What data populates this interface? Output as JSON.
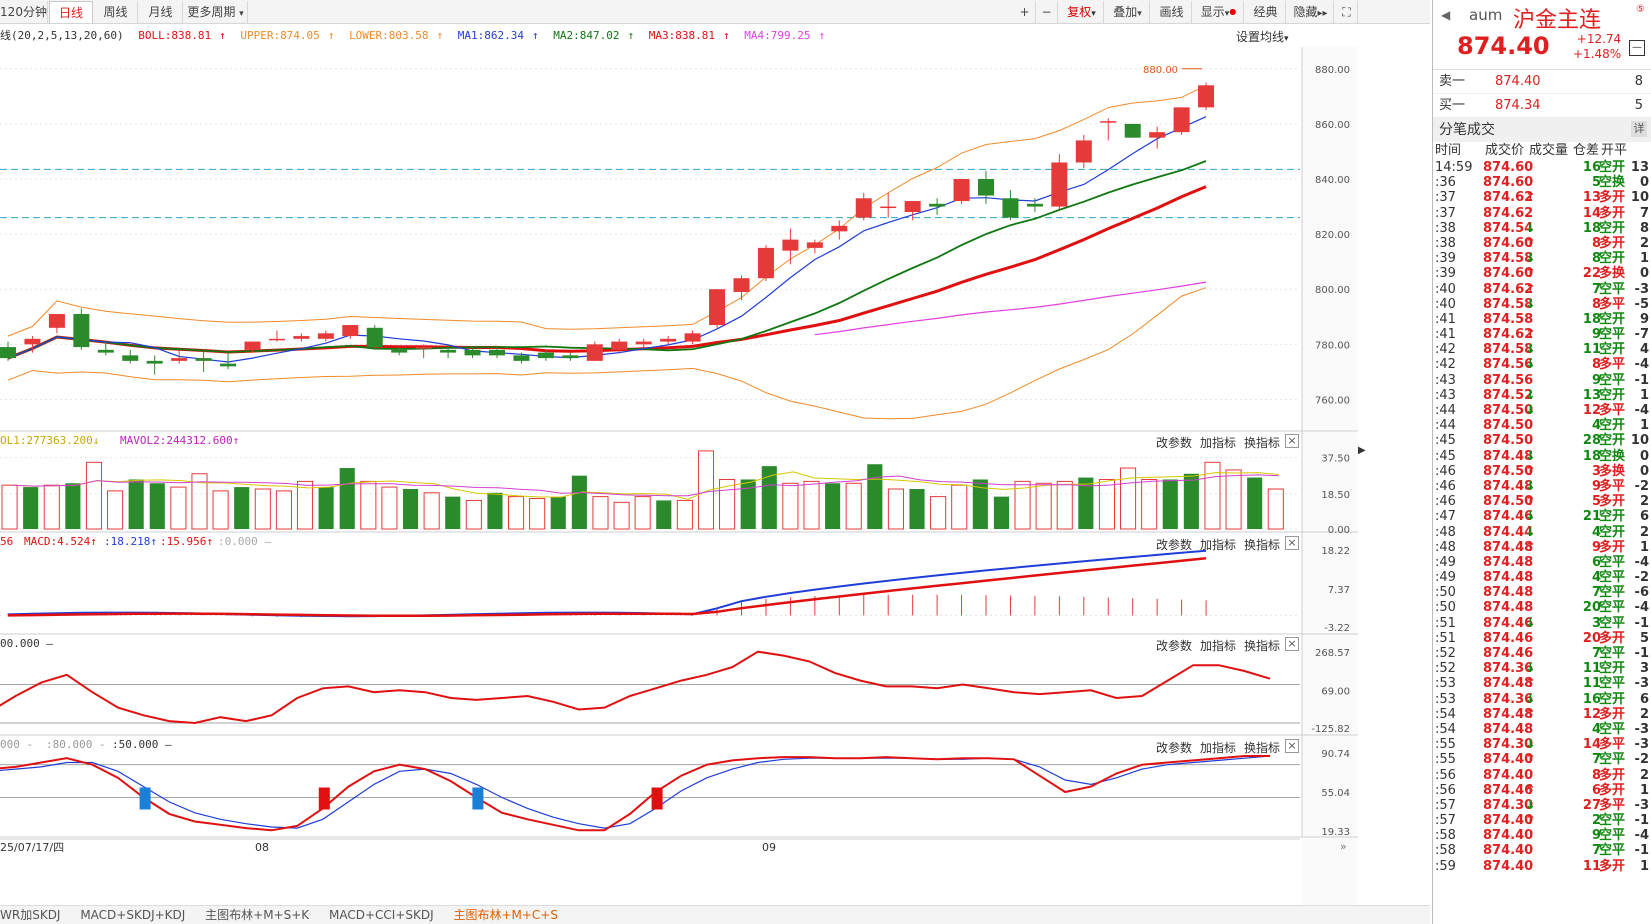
{
  "toolbar": {
    "tabs": [
      "120分钟",
      "日线",
      "周线",
      "月线",
      "更多周期"
    ],
    "right_buttons": [
      "复权",
      "叠加",
      "画线",
      "显示",
      "经典",
      "隐藏"
    ]
  },
  "indicator_bar": {
    "boll": "线(20,2,5,13,20,60)",
    "boll_val": "BOLL:838.81",
    "upper": "UPPER:874.05",
    "lower": "LOWER:803.58",
    "ma1": "MA1:862.34",
    "ma2": "MA2:847.02",
    "ma3": "MA3:838.81",
    "ma4": "MA4:799.25",
    "settings": "设置均线"
  },
  "colors": {
    "up": "#e63a3a",
    "down": "#2b8a2b",
    "ma1": "#1f3ed8",
    "ma2": "#117711",
    "ma3": "#e01010",
    "ma4": "#e040e0",
    "boll": "#f08a2a"
  },
  "chart_data": {
    "type": "candlestick",
    "max_label": "880.00",
    "price_ticks": [
      "880.00",
      "860.00",
      "840.00",
      "820.00",
      "800.00",
      "780.00",
      "760.00"
    ],
    "price_ylim": [
      750,
      885
    ],
    "x_labels": [
      "25/07/17/四",
      "08",
      "09"
    ],
    "candles": [
      {
        "o": 779,
        "h": 781,
        "l": 774,
        "c": 775
      },
      {
        "o": 780,
        "h": 783,
        "l": 777,
        "c": 782
      },
      {
        "o": 786,
        "h": 791,
        "l": 784,
        "c": 791
      },
      {
        "o": 791,
        "h": 793,
        "l": 778,
        "c": 779
      },
      {
        "o": 778,
        "h": 781,
        "l": 776,
        "c": 777
      },
      {
        "o": 776,
        "h": 778,
        "l": 773,
        "c": 774
      },
      {
        "o": 774,
        "h": 776,
        "l": 769,
        "c": 773
      },
      {
        "o": 774,
        "h": 778,
        "l": 773,
        "c": 775
      },
      {
        "o": 775,
        "h": 778,
        "l": 770,
        "c": 774
      },
      {
        "o": 773,
        "h": 777,
        "l": 771,
        "c": 772
      },
      {
        "o": 778,
        "h": 781,
        "l": 777,
        "c": 781
      },
      {
        "o": 782,
        "h": 785,
        "l": 781,
        "c": 782
      },
      {
        "o": 782,
        "h": 784,
        "l": 781,
        "c": 783
      },
      {
        "o": 782,
        "h": 785,
        "l": 781,
        "c": 784
      },
      {
        "o": 783,
        "h": 787,
        "l": 782,
        "c": 787
      },
      {
        "o": 786,
        "h": 787,
        "l": 778,
        "c": 779
      },
      {
        "o": 778,
        "h": 779,
        "l": 776,
        "c": 777
      },
      {
        "o": 779,
        "h": 780,
        "l": 775,
        "c": 779
      },
      {
        "o": 778,
        "h": 780,
        "l": 775,
        "c": 777
      },
      {
        "o": 778,
        "h": 779,
        "l": 775,
        "c": 776
      },
      {
        "o": 778,
        "h": 779,
        "l": 775,
        "c": 776
      },
      {
        "o": 776,
        "h": 777,
        "l": 773,
        "c": 774
      },
      {
        "o": 777,
        "h": 778,
        "l": 774,
        "c": 775
      },
      {
        "o": 776,
        "h": 777,
        "l": 774,
        "c": 775
      },
      {
        "o": 774,
        "h": 781,
        "l": 774,
        "c": 780
      },
      {
        "o": 778,
        "h": 782,
        "l": 777,
        "c": 781
      },
      {
        "o": 780,
        "h": 782,
        "l": 779,
        "c": 781
      },
      {
        "o": 781,
        "h": 783,
        "l": 780,
        "c": 782
      },
      {
        "o": 781,
        "h": 785,
        "l": 780,
        "c": 784
      },
      {
        "o": 787,
        "h": 800,
        "l": 786,
        "c": 800
      },
      {
        "o": 799,
        "h": 805,
        "l": 796,
        "c": 804
      },
      {
        "o": 804,
        "h": 816,
        "l": 803,
        "c": 815
      },
      {
        "o": 814,
        "h": 822,
        "l": 809,
        "c": 818
      },
      {
        "o": 815,
        "h": 818,
        "l": 813,
        "c": 817
      },
      {
        "o": 821,
        "h": 825,
        "l": 818,
        "c": 823
      },
      {
        "o": 826,
        "h": 835,
        "l": 825,
        "c": 833
      },
      {
        "o": 830,
        "h": 835,
        "l": 826,
        "c": 830
      },
      {
        "o": 828,
        "h": 832,
        "l": 825,
        "c": 832
      },
      {
        "o": 831,
        "h": 833,
        "l": 827,
        "c": 830
      },
      {
        "o": 832,
        "h": 840,
        "l": 831,
        "c": 840
      },
      {
        "o": 840,
        "h": 843,
        "l": 831,
        "c": 834
      },
      {
        "o": 833,
        "h": 836,
        "l": 825,
        "c": 826
      },
      {
        "o": 831,
        "h": 833,
        "l": 828,
        "c": 830
      },
      {
        "o": 830,
        "h": 849,
        "l": 829,
        "c": 846
      },
      {
        "o": 846,
        "h": 856,
        "l": 844,
        "c": 854
      },
      {
        "o": 861,
        "h": 862,
        "l": 854,
        "c": 861
      },
      {
        "o": 860,
        "h": 860,
        "l": 855,
        "c": 855
      },
      {
        "o": 855,
        "h": 859,
        "l": 851,
        "c": 857
      },
      {
        "o": 857,
        "h": 866,
        "l": 856,
        "c": 866
      },
      {
        "o": 866,
        "h": 875,
        "l": 865,
        "c": 874
      }
    ],
    "vol_label": "OL1:277363.200",
    "vol2_label": "MAVOL2:244312.600",
    "vol_ticks": [
      "37.50",
      "18.50",
      "0.00"
    ],
    "volumes": [
      23,
      22,
      23,
      24,
      35,
      20,
      26,
      24,
      22,
      29,
      20,
      22,
      21,
      20,
      25,
      22,
      32,
      25,
      22,
      21,
      19,
      17,
      15,
      19,
      17,
      16,
      17,
      28,
      17,
      14,
      17,
      15,
      15,
      41,
      26,
      26,
      33,
      24,
      25,
      24,
      24,
      34,
      21,
      21,
      17,
      23,
      26,
      17,
      25,
      24,
      25,
      27,
      26,
      32,
      26,
      26,
      29,
      35,
      31,
      27,
      21
    ],
    "macd_label_1": "MACD:4.524",
    "macd_label_2": ":18.218",
    "macd_label_3": ":15.956",
    "macd_label_4": ":0.000",
    "macd_ticks": [
      "18.22",
      "7.37",
      "-3.22"
    ],
    "cci_label": "00.000",
    "cci_ticks": [
      "268.57",
      "69.00",
      "-125.82"
    ],
    "kdj_label_1": "000",
    "kdj_label_2": ":80.000",
    "kdj_label_3": ":50.000",
    "kdj_ticks": [
      "90.74",
      "55.04",
      "19.33"
    ]
  },
  "panel_tools": [
    "改参数",
    "加指标",
    "换指标"
  ],
  "bottom_tabs": [
    "WR加SKDJ",
    "MACD+SKDJ+KDJ",
    "主图布林+M+S+K",
    "MACD+CCI+SKDJ",
    "主图布林+M+C+S"
  ],
  "quote": {
    "symbol": "aum",
    "name": "沪金主连",
    "price": "874.40",
    "change": "+12.74",
    "change_pct": "+1.48%",
    "sell_label": "卖一",
    "sell_price": "874.40",
    "sell_vol": "8",
    "buy_label": "买一",
    "buy_price": "874.34",
    "buy_vol": "5",
    "trades_title": "分笔成交",
    "detail": "详",
    "headers": [
      "时间",
      "成交价",
      "成交量",
      "仓差",
      "开平"
    ],
    "trades": [
      [
        "14:59",
        "874.60",
        "",
        "16",
        "13",
        "空开"
      ],
      [
        ":36",
        "874.60",
        "",
        "5",
        "0",
        "空换"
      ],
      [
        ":37",
        "874.62",
        "↑",
        "13",
        "10",
        "多开"
      ],
      [
        ":37",
        "874.62",
        "",
        "14",
        "7",
        "多开"
      ],
      [
        ":38",
        "874.54",
        "↓",
        "18",
        "8",
        "空开"
      ],
      [
        ":38",
        "874.60",
        "↑",
        "8",
        "2",
        "多开"
      ],
      [
        ":39",
        "874.58",
        "↓",
        "8",
        "1",
        "空开"
      ],
      [
        ":39",
        "874.60",
        "↑",
        "22",
        "0",
        "多换"
      ],
      [
        ":40",
        "874.62",
        "↑",
        "7",
        "-3",
        "空平"
      ],
      [
        ":40",
        "874.58",
        "↓",
        "8",
        "-5",
        "多平"
      ],
      [
        ":41",
        "874.58",
        "",
        "18",
        "9",
        "空开"
      ],
      [
        ":41",
        "874.62",
        "↑",
        "9",
        "-7",
        "空平"
      ],
      [
        ":42",
        "874.58",
        "↓",
        "11",
        "4",
        "空开"
      ],
      [
        ":42",
        "874.56",
        "↓",
        "8",
        "-4",
        "多平"
      ],
      [
        ":43",
        "874.56",
        "",
        "9",
        "-1",
        "空平"
      ],
      [
        ":43",
        "874.52",
        "↓",
        "13",
        "1",
        "空开"
      ],
      [
        ":44",
        "874.50",
        "↓",
        "12",
        "-4",
        "多平"
      ],
      [
        ":44",
        "874.50",
        "",
        "4",
        "1",
        "空开"
      ],
      [
        ":45",
        "874.50",
        "",
        "28",
        "10",
        "空开"
      ],
      [
        ":45",
        "874.48",
        "↓",
        "18",
        "0",
        "空换"
      ],
      [
        ":46",
        "874.50",
        "↑",
        "3",
        "0",
        "多换"
      ],
      [
        ":46",
        "874.48",
        "↓",
        "9",
        "-2",
        "多平"
      ],
      [
        ":46",
        "874.50",
        "↑",
        "5",
        "2",
        "多开"
      ],
      [
        ":47",
        "874.46",
        "↓",
        "21",
        "6",
        "空开"
      ],
      [
        ":48",
        "874.44",
        "↓",
        "4",
        "2",
        "空开"
      ],
      [
        ":48",
        "874.48",
        "↑",
        "9",
        "1",
        "多开"
      ],
      [
        ":49",
        "874.48",
        "",
        "6",
        "-4",
        "空平"
      ],
      [
        ":49",
        "874.48",
        "",
        "4",
        "-2",
        "空平"
      ],
      [
        ":50",
        "874.48",
        "",
        "7",
        "-6",
        "空平"
      ],
      [
        ":50",
        "874.48",
        "",
        "20",
        "-4",
        "空平"
      ],
      [
        ":51",
        "874.46",
        "↓",
        "3",
        "-1",
        "空平"
      ],
      [
        ":51",
        "874.46",
        "",
        "20",
        "5",
        "多开"
      ],
      [
        ":52",
        "874.46",
        "",
        "7",
        "-1",
        "空平"
      ],
      [
        ":52",
        "874.36",
        "↓",
        "11",
        "3",
        "空开"
      ],
      [
        ":53",
        "874.48",
        "↑",
        "11",
        "-3",
        "空平"
      ],
      [
        ":53",
        "874.36",
        "↓",
        "16",
        "6",
        "空开"
      ],
      [
        ":54",
        "874.48",
        "↑",
        "12",
        "2",
        "多开"
      ],
      [
        ":54",
        "874.48",
        "",
        "4",
        "-3",
        "空平"
      ],
      [
        ":55",
        "874.30",
        "↓",
        "14",
        "-3",
        "多平"
      ],
      [
        ":55",
        "874.40",
        "↑",
        "7",
        "-2",
        "空平"
      ],
      [
        ":56",
        "874.40",
        "",
        "8",
        "2",
        "多开"
      ],
      [
        ":56",
        "874.46",
        "↑",
        "6",
        "1",
        "多开"
      ],
      [
        ":57",
        "874.30",
        "↓",
        "27",
        "-3",
        "多平"
      ],
      [
        ":57",
        "874.40",
        "↑",
        "2",
        "-1",
        "空平"
      ],
      [
        ":58",
        "874.40",
        "",
        "9",
        "-4",
        "空平"
      ],
      [
        ":58",
        "874.40",
        "",
        "7",
        "-1",
        "空平"
      ],
      [
        ":59",
        "874.40",
        "",
        "11",
        "1",
        "多开"
      ]
    ]
  }
}
